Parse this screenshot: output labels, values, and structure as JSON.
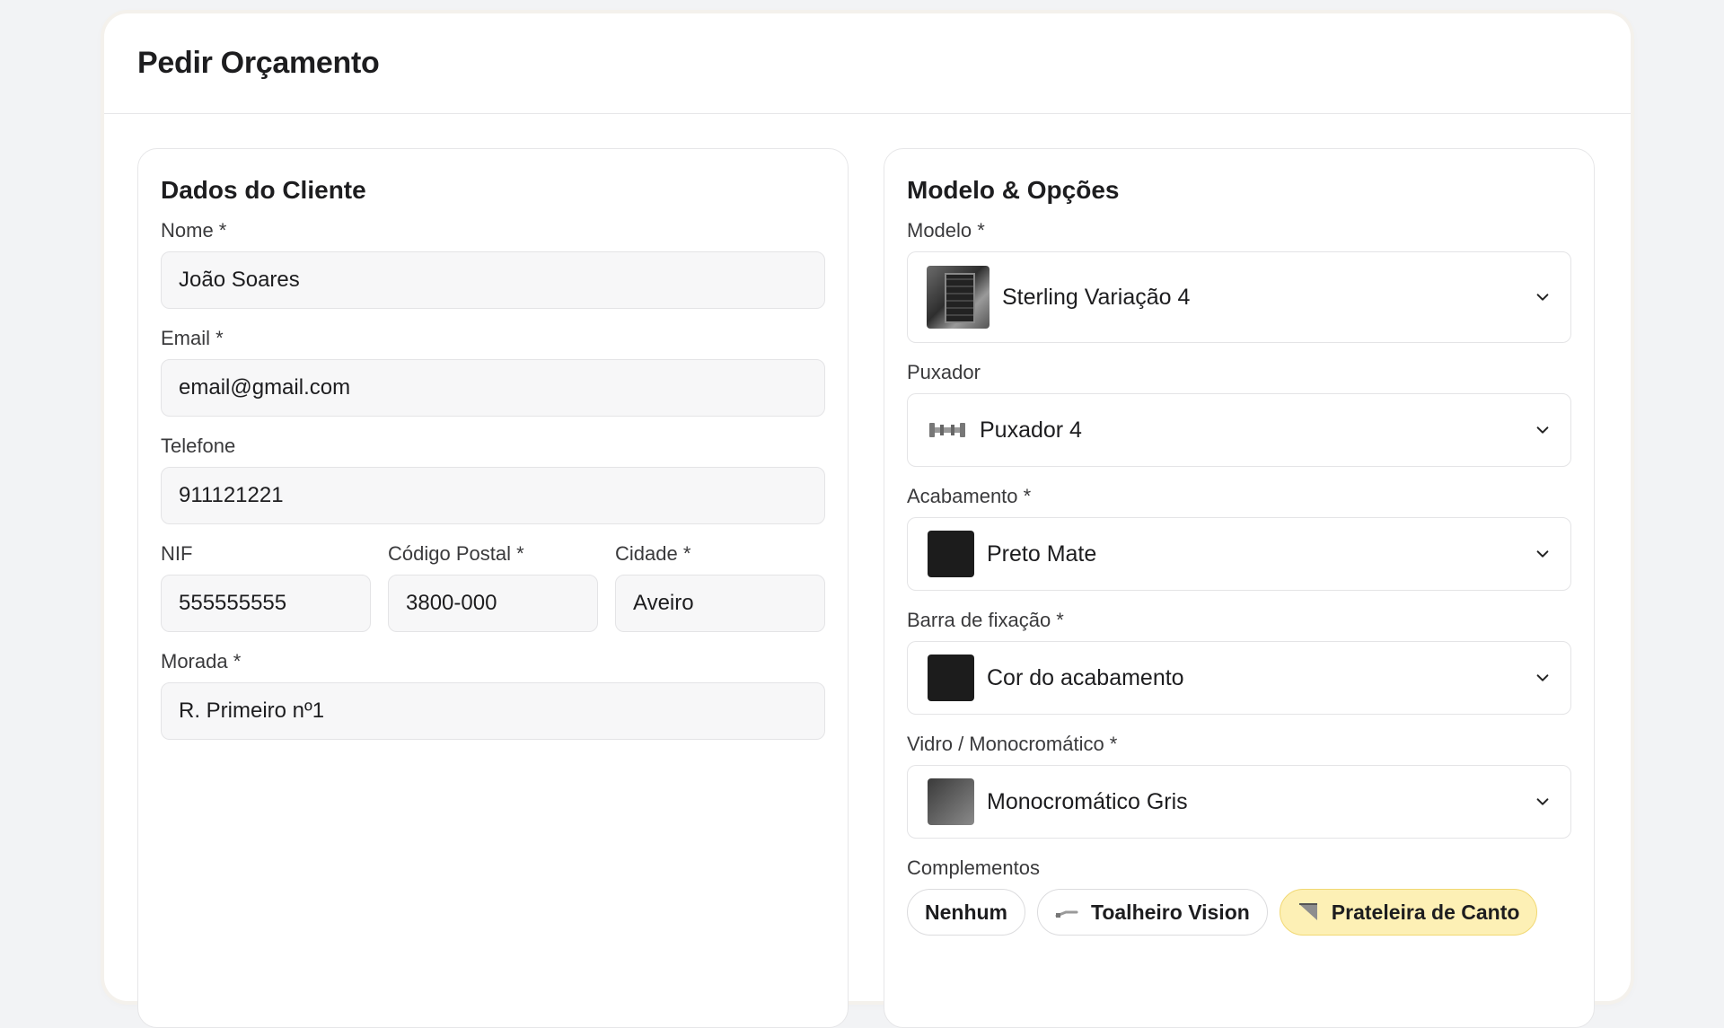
{
  "page": {
    "title": "Pedir Orçamento"
  },
  "client": {
    "title": "Dados do Cliente",
    "nome": {
      "label": "Nome *",
      "value": "João Soares"
    },
    "email": {
      "label": "Email *",
      "value": "email@gmail.com"
    },
    "telefone": {
      "label": "Telefone",
      "value": "911121221"
    },
    "nif": {
      "label": "NIF",
      "value": "555555555"
    },
    "codigo_postal": {
      "label": "Código Postal *",
      "value": "3800-000"
    },
    "cidade": {
      "label": "Cidade *",
      "value": "Aveiro"
    },
    "morada": {
      "label": "Morada *",
      "value": "R. Primeiro nº1"
    }
  },
  "options": {
    "title": "Modelo & Opções",
    "modelo": {
      "label": "Modelo *",
      "value": "Sterling Variação 4"
    },
    "puxador": {
      "label": "Puxador",
      "value": "Puxador 4"
    },
    "acabamento": {
      "label": "Acabamento *",
      "value": "Preto Mate",
      "swatch": "#1c1c1c"
    },
    "barra": {
      "label": "Barra de fixação *",
      "value": "Cor do acabamento",
      "swatch": "#1c1c1c"
    },
    "vidro": {
      "label": "Vidro / Monocromático *",
      "value": "Monocromático Gris"
    },
    "complementos": {
      "label": "Complementos",
      "items": [
        {
          "label": "Nenhum",
          "selected": false
        },
        {
          "label": "Toalheiro Vision",
          "selected": false
        },
        {
          "label": "Prateleira de Canto",
          "selected": true
        }
      ]
    }
  },
  "colors": {
    "accent_chip_bg": "#fdf0b5",
    "accent_chip_border": "#f1d873"
  }
}
